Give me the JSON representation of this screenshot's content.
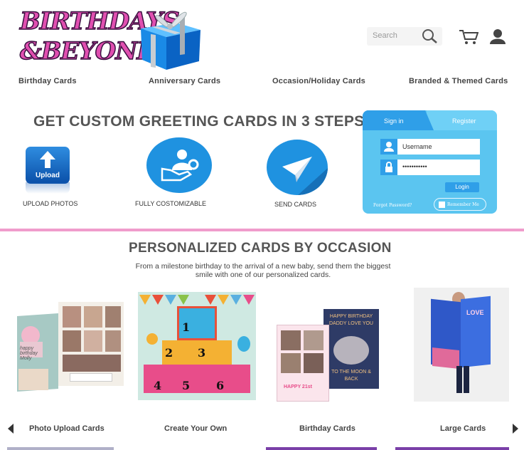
{
  "logo": {
    "line1": "BIRTHDAYS",
    "line2": "&BEYOND"
  },
  "search": {
    "placeholder": "Search"
  },
  "nav": [
    "Birthday Cards",
    "Anniversary Cards",
    "Occasion/Holiday  Cards",
    "Branded & Themed  Cards"
  ],
  "steps": {
    "title": "GET CUSTOM GREETING CARDS IN 3 STEPS",
    "upload_icon_text": "Upload",
    "items": [
      "UPLOAD PHOTOS",
      "FULLY COSTOMIZABLE",
      "SEND CARDS"
    ]
  },
  "login": {
    "tab_signin": "Sign in",
    "tab_register": "Register",
    "username": "Username",
    "password": "•••••••••••",
    "button": "Login",
    "forgot": "Forgot Password?",
    "remember": "Remember Me"
  },
  "occasion": {
    "title": "PERSONALIZED CARDS BY OCCASION",
    "subtitle": "From a milestone birthday to the arrival of a new baby, send them the biggest smile with one of our personalized cards."
  },
  "cards": [
    {
      "label": "Photo Upload Cards",
      "card_text": "happy birthday Molly"
    },
    {
      "label": "Create Your Own",
      "numbers": [
        "1",
        "2",
        "3",
        "4",
        "5",
        "6"
      ]
    },
    {
      "label": "Birthday Cards",
      "card_text": "HAPPY BIRTHDAY DADDY LOVE YOU",
      "card_text2": "TO THE MOON & BACK",
      "card_text3": "HAPPY 21st"
    },
    {
      "label": "Large Cards",
      "card_text": "LOVE"
    }
  ],
  "colors": {
    "accent": "#f09ccc",
    "login_bg": "#5bc5f0",
    "icon_blue": "#1f92e0"
  }
}
